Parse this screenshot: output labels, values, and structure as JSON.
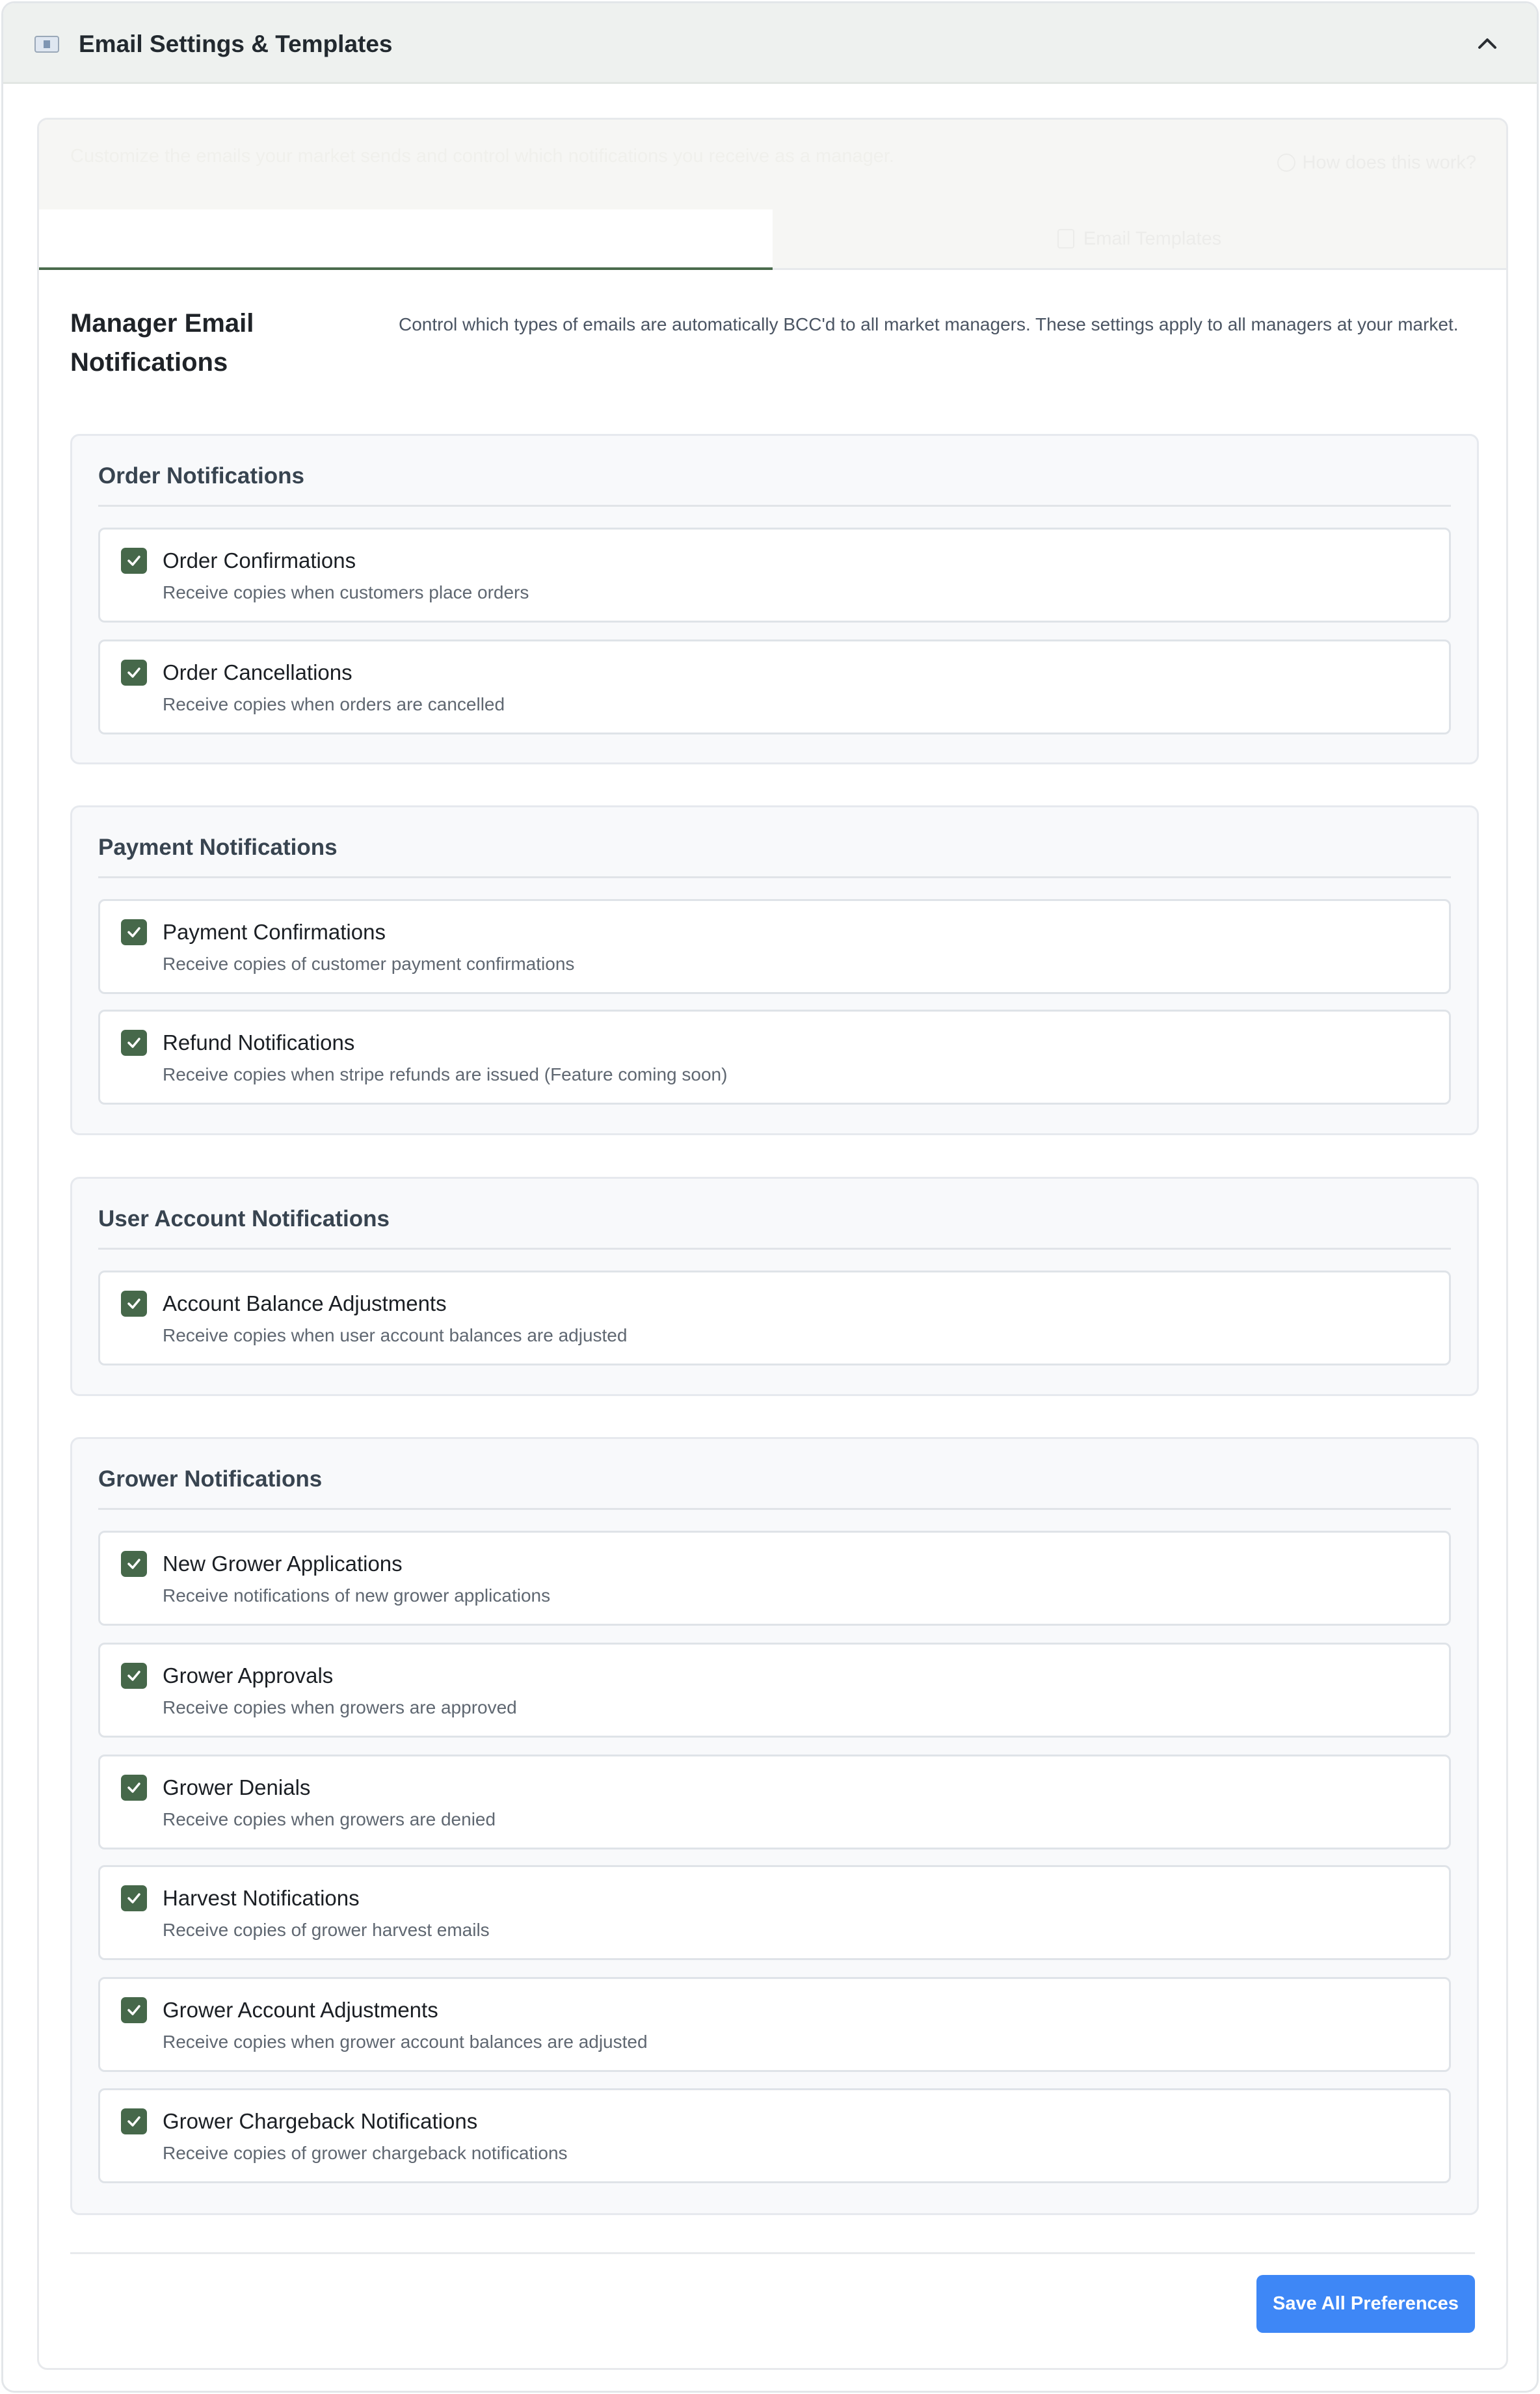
{
  "header": {
    "title": "Email Settings & Templates",
    "icon": "envelope-icon",
    "collapse_icon": "chevron-up-icon"
  },
  "intro": {
    "text": "Customize the emails your market sends and control which notifications you receive as a manager.",
    "help_link": "How does this work?"
  },
  "tabs": [
    {
      "label": "",
      "active": true
    },
    {
      "label": "Email Templates",
      "active": false,
      "icon": "document-icon"
    }
  ],
  "section": {
    "title": "Manager Email Notifications",
    "description": "Control which types of emails are automatically BCC'd to all market managers. These settings apply to all managers at your market."
  },
  "groups": [
    {
      "title": "Order Notifications",
      "items": [
        {
          "label": "Order Confirmations",
          "description": "Receive copies when customers place orders",
          "checked": true
        },
        {
          "label": "Order Cancellations",
          "description": "Receive copies when orders are cancelled",
          "checked": true
        }
      ]
    },
    {
      "title": "Payment Notifications",
      "items": [
        {
          "label": "Payment Confirmations",
          "description": "Receive copies of customer payment confirmations",
          "checked": true
        },
        {
          "label": "Refund Notifications",
          "description": "Receive copies when stripe refunds are issued (Feature coming soon)",
          "checked": true
        }
      ]
    },
    {
      "title": "User Account Notifications",
      "items": [
        {
          "label": "Account Balance Adjustments",
          "description": "Receive copies when user account balances are adjusted",
          "checked": true
        }
      ]
    },
    {
      "title": "Grower Notifications",
      "items": [
        {
          "label": "New Grower Applications",
          "description": "Receive notifications of new grower applications",
          "checked": true
        },
        {
          "label": "Grower Approvals",
          "description": "Receive copies when growers are approved",
          "checked": true
        },
        {
          "label": "Grower Denials",
          "description": "Receive copies when growers are denied",
          "checked": true
        },
        {
          "label": "Harvest Notifications",
          "description": "Receive copies of grower harvest emails",
          "checked": true
        },
        {
          "label": "Grower Account Adjustments",
          "description": "Receive copies when grower account balances are adjusted",
          "checked": true
        },
        {
          "label": "Grower Chargeback Notifications",
          "description": "Receive copies of grower chargeback notifications",
          "checked": true
        }
      ]
    }
  ],
  "footer": {
    "save_label": "Save All Preferences"
  },
  "colors": {
    "accent_green": "#46684a",
    "primary_blue": "#3e87f6"
  }
}
